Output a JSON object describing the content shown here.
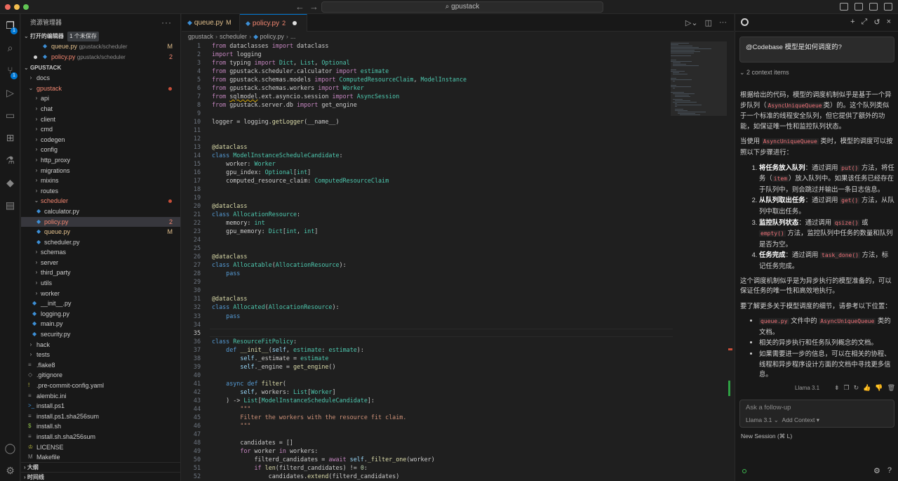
{
  "titlebar": {
    "search_text": "⌕ gpustack",
    "back": "←",
    "forward": "→"
  },
  "sidebar": {
    "title": "资源管理器",
    "more": "···",
    "open_editors_label": "打开的编辑器",
    "unsaved_badge": "1 个未保存",
    "open_editors": [
      {
        "name": "queue.py",
        "path": "gpustack/scheduler",
        "status": "M"
      },
      {
        "name": "policy.py",
        "path": "gpustack/scheduler",
        "status": "2"
      }
    ],
    "project_label": "GPUSTACK",
    "tree": [
      {
        "label": "docs",
        "status": ""
      },
      {
        "label": "gpustack",
        "status": ""
      },
      {
        "label": "api",
        "status": ""
      },
      {
        "label": "chat",
        "status": ""
      },
      {
        "label": "client",
        "status": ""
      },
      {
        "label": "cmd",
        "status": ""
      },
      {
        "label": "codegen",
        "status": ""
      },
      {
        "label": "config",
        "status": ""
      },
      {
        "label": "http_proxy",
        "status": ""
      },
      {
        "label": "migrations",
        "status": ""
      },
      {
        "label": "mixins",
        "status": ""
      },
      {
        "label": "routes",
        "status": ""
      },
      {
        "label": "scheduler",
        "status": ""
      },
      {
        "label": "calculator.py",
        "status": ""
      },
      {
        "label": "policy.py",
        "status": "2"
      },
      {
        "label": "queue.py",
        "status": "M"
      },
      {
        "label": "scheduler.py",
        "status": ""
      },
      {
        "label": "schemas",
        "status": ""
      },
      {
        "label": "server",
        "status": ""
      },
      {
        "label": "third_party",
        "status": ""
      },
      {
        "label": "utils",
        "status": ""
      },
      {
        "label": "worker",
        "status": ""
      },
      {
        "label": "__init__.py",
        "status": ""
      },
      {
        "label": "logging.py",
        "status": ""
      },
      {
        "label": "main.py",
        "status": ""
      },
      {
        "label": "security.py",
        "status": ""
      },
      {
        "label": "hack",
        "status": ""
      },
      {
        "label": "tests",
        "status": ""
      },
      {
        "label": ".flake8",
        "status": ""
      },
      {
        "label": ".gitignore",
        "status": ""
      },
      {
        "label": ".pre-commit-config.yaml",
        "status": ""
      },
      {
        "label": "alembic.ini",
        "status": ""
      },
      {
        "label": "install.ps1",
        "status": ""
      },
      {
        "label": "install.ps1.sha256sum",
        "status": ""
      },
      {
        "label": "install.sh",
        "status": ""
      },
      {
        "label": "install.sh.sha256sum",
        "status": ""
      },
      {
        "label": "LICENSE",
        "status": ""
      },
      {
        "label": "Makefile",
        "status": ""
      }
    ],
    "outline_label": "大纲",
    "timeline_label": "时间线"
  },
  "activity": {
    "explorer_badge": "1",
    "scm_badge": "1"
  },
  "editor": {
    "tabs": [
      {
        "name": "queue.py",
        "status": "M"
      },
      {
        "name": "policy.py",
        "status": "2"
      }
    ],
    "breadcrumb": [
      "gpustack",
      "scheduler",
      "policy.py",
      "..."
    ],
    "line_numbers": [
      "1",
      "2",
      "3",
      "4",
      "5",
      "6",
      "7",
      "8",
      "9",
      "10",
      "11",
      "12",
      "13",
      "14",
      "15",
      "16",
      "17",
      "18",
      "19",
      "20",
      "21",
      "22",
      "23",
      "24",
      "25",
      "26",
      "27",
      "28",
      "29",
      "30",
      "31",
      "32",
      "33",
      "34",
      "35",
      "36",
      "37",
      "38",
      "39",
      "40",
      "41",
      "42",
      "43",
      "44",
      "45",
      "46",
      "47",
      "48",
      "49",
      "50",
      "51",
      "52"
    ],
    "current_line": "35",
    "code_lines": [
      "from dataclasses import dataclass",
      "import logging",
      "from typing import Dict, List, Optional",
      "from gpustack.scheduler.calculator import estimate",
      "from gpustack.schemas.models import ComputedResourceClaim, ModelInstance",
      "from gpustack.schemas.workers import Worker",
      "from sqlmodel.ext.asyncio.session import AsyncSession",
      "from gpustack.server.db import get_engine",
      "",
      "logger = logging.getLogger(__name__)",
      "",
      "",
      "@dataclass",
      "class ModelInstanceScheduleCandidate:",
      "    worker: Worker",
      "    gpu_index: Optional[int]",
      "    computed_resource_claim: ComputedResourceClaim",
      "",
      "",
      "@dataclass",
      "class AllocationResource:",
      "    memory: int",
      "    gpu_memory: Dict[int, int]",
      "",
      "",
      "@dataclass",
      "class Allocatable(AllocationResource):",
      "    pass",
      "",
      "",
      "@dataclass",
      "class Allocated(AllocationResource):",
      "    pass",
      "",
      "",
      "class ResourceFitPolicy:",
      "    def __init__(self, estimate: estimate):",
      "        self._estimate = estimate",
      "        self._engine = get_engine()",
      "",
      "    async def filter(",
      "        self, workers: List[Worker]",
      "    ) -> List[ModelInstanceScheduleCandidate]:",
      "        \"\"\"",
      "        Filter the workers with the resource fit claim.",
      "        \"\"\"",
      "",
      "        candidates = []",
      "        for worker in workers:",
      "            filterd_candidates = await self._filter_one(worker)",
      "            if len(filterd_candidates) != 0:",
      "                candidates.extend(filterd_candidates)"
    ]
  },
  "chat": {
    "query": "@Codebase 模型是如何调度的?",
    "context_items": "2 context items",
    "intro": "根据给出的代码，模型的调度机制似乎是基于一个异步队列（AsyncUniqueQueue类）的。这个队列类似于一个标准的线程安全队列，但它提供了额外的功能，如保证唯一性和监控队列状态。",
    "usage": "当使用 AsyncUniqueQueue 类时，模型的调度可以按照以下步骤进行：",
    "steps": [
      {
        "title": "将任务放入队列",
        "text": "：通过调用 put() 方法，将任务（item）放入队列中。如果该任务已经存在于队列中，则会跳过并输出一条日志信息。"
      },
      {
        "title": "从队列取出任务",
        "text": "：通过调用 get() 方法，从队列中取出任务。"
      },
      {
        "title": "监控队列状态",
        "text": "：通过调用 qsize() 或 empty() 方法，监控队列中任务的数量和队列是否为空。"
      },
      {
        "title": "任务完成",
        "text": "：通过调用 task_done() 方法，标记任务完成。"
      }
    ],
    "summary": "这个调度机制似乎是为异步执行的模型准备的，可以保证任务的唯一性和高效地执行。",
    "more_info": "要了解更多关于模型调度的细节，请参考以下位置：",
    "refs": [
      "queue.py 文件中的 AsyncUniqueQueue 类的文档。",
      "相关的异步执行和任务队列概念的文档。",
      "如果需要进一步的信息，可以在相关的协程、线程和异步程序设计方面的文档中寻找更多信息。"
    ],
    "model_label": "Llama 3.1",
    "followup_placeholder": "Ask a follow-up",
    "model_select": "Llama 3.1 ⌄",
    "add_context": "Add Context ▾",
    "new_session": "New Session (⌘ L)"
  }
}
